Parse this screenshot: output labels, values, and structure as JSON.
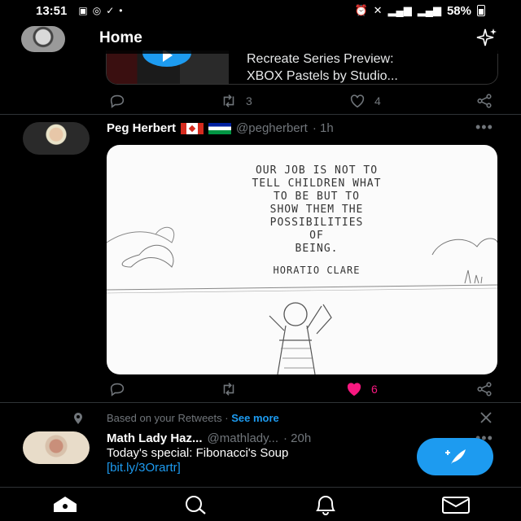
{
  "status_bar": {
    "time": "13:51",
    "left_icons": [
      "gallery-icon",
      "whatsapp-icon",
      "check-icon",
      "dot-icon"
    ],
    "right_icons": [
      "alarm-icon",
      "mute-icon",
      "signal-icon",
      "signal-icon"
    ],
    "battery": "58%"
  },
  "header": {
    "title": "Home",
    "sparkle_icon": "sparkle-icon"
  },
  "prev_tweet": {
    "card_title": "Recreate Series Preview:\nXBOX Pastels by Studio...",
    "retweets": "3",
    "likes": "4"
  },
  "tweet": {
    "name": "Peg Herbert",
    "handle": "@pegherbert",
    "time": "· 1h",
    "quote_lines": [
      "OUR JOB IS NOT TO",
      "TELL CHILDREN WHAT",
      "TO BE BUT TO",
      "SHOW THEM THE",
      "POSSIBILITIES",
      "OF",
      "BEING."
    ],
    "quote_author": "HORATIO CLARE",
    "likes": "6",
    "like_color": "#f91880"
  },
  "context": {
    "text": "Based on your Retweets",
    "sep": "·",
    "link": "See more"
  },
  "tweet3": {
    "name": "Math Lady Haz...",
    "handle": "@mathlady...",
    "time": "· 20h",
    "text": "Today's special: Fibonacci's Soup",
    "link": "[bit.ly/3Orartr]"
  },
  "colors": {
    "accent": "#1d9bf0",
    "background": "#000000"
  }
}
